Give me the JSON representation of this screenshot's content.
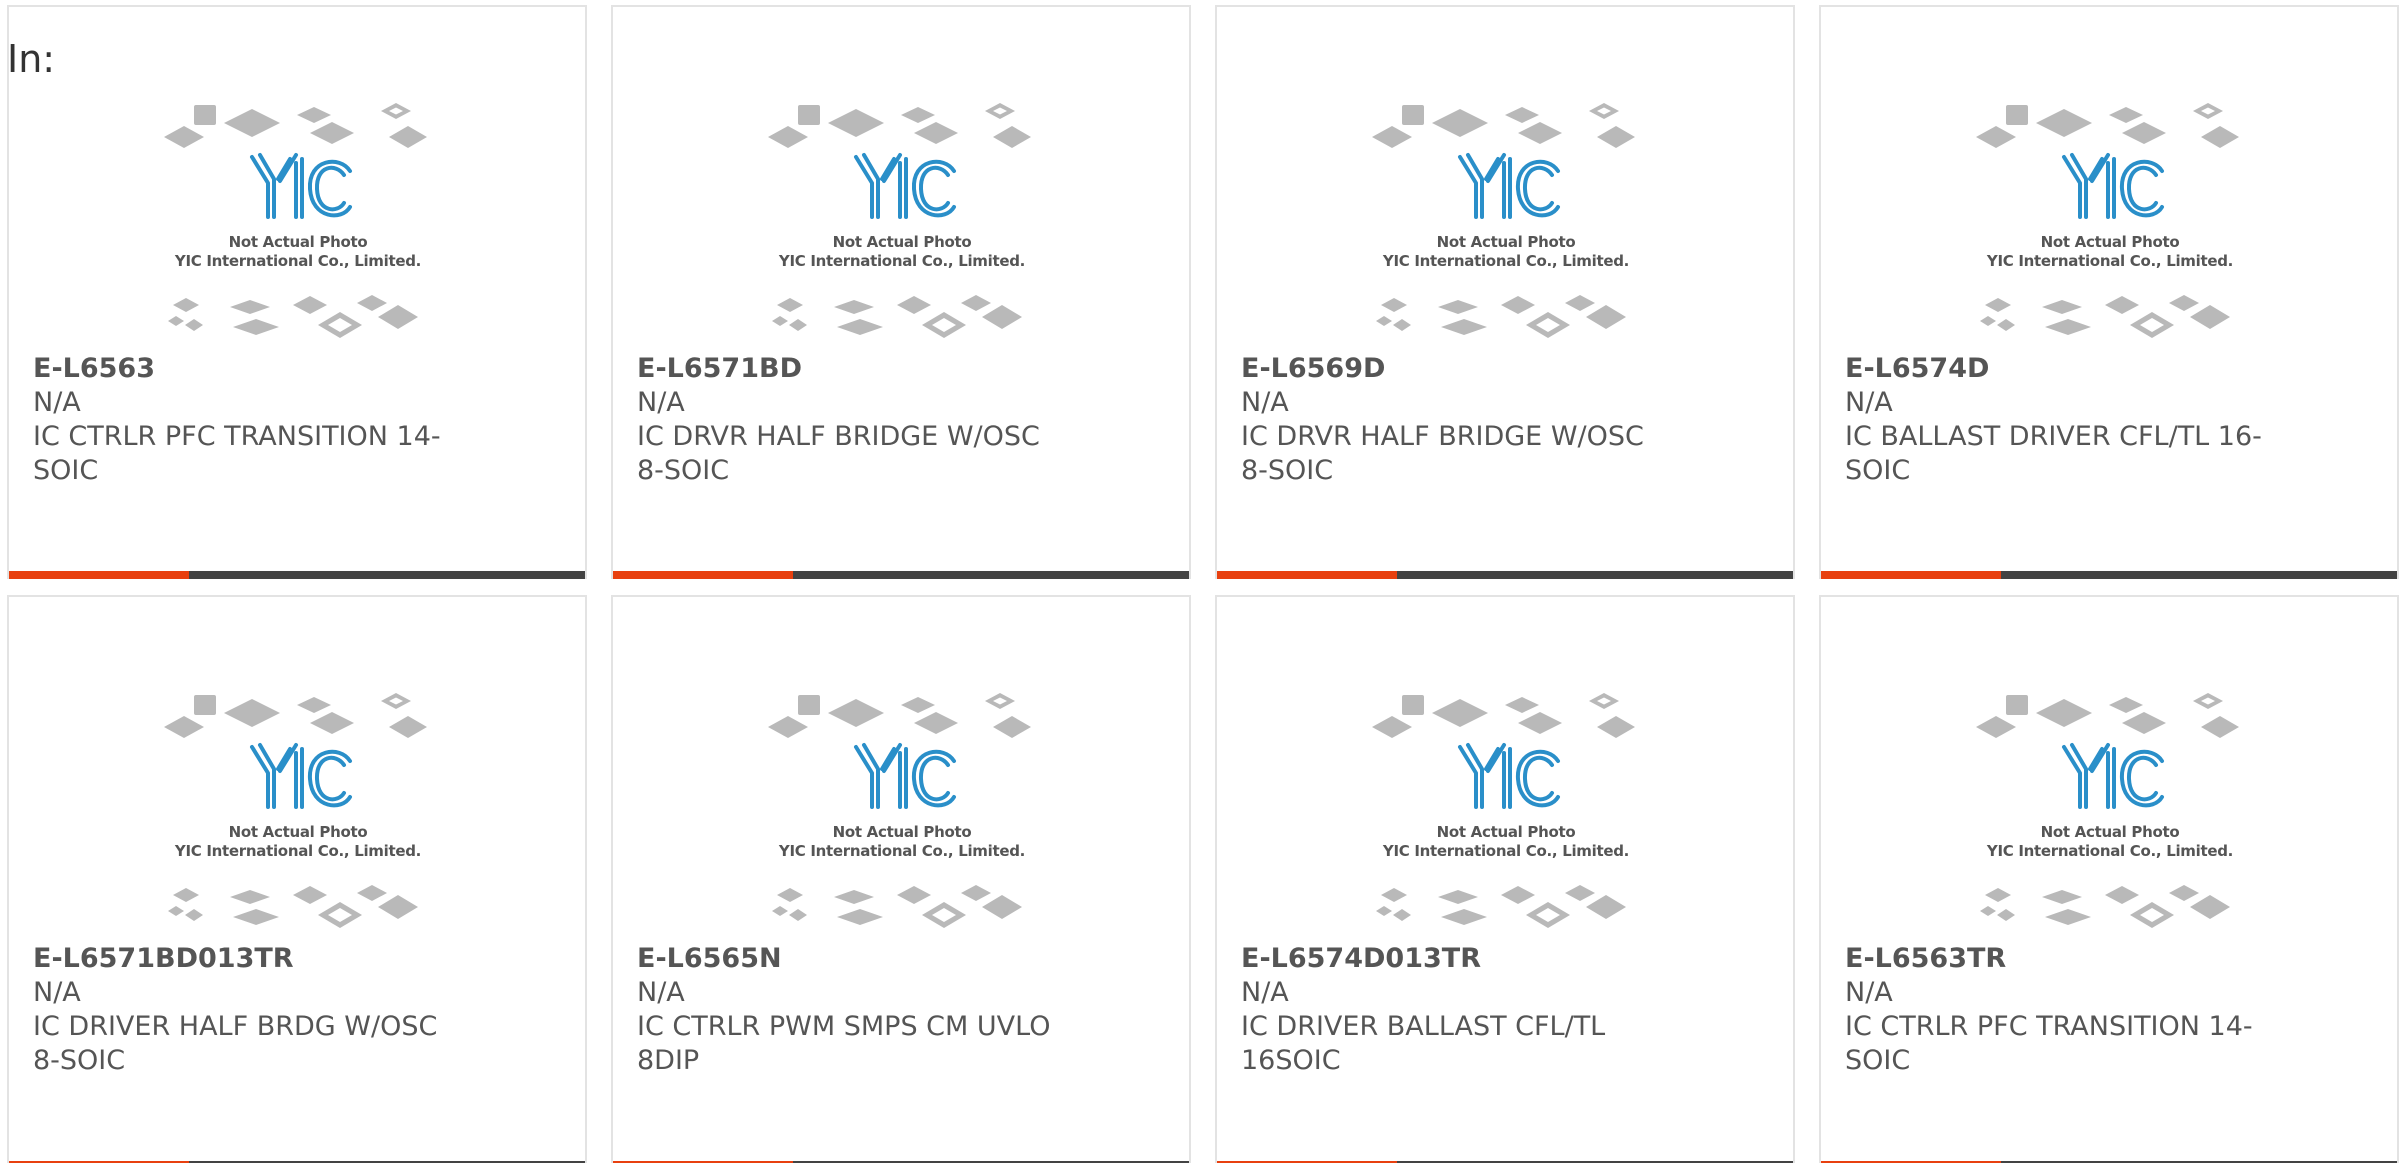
{
  "label": "In:",
  "placeholder_image": {
    "line1": "Not Actual Photo",
    "line2": "YIC International Co., Limited.",
    "logo_text": "YIC",
    "logo_color": "#2a8fc9",
    "chip_color": "#b9b9b9"
  },
  "accent_color": "#e8400f",
  "bar_color": "#434343",
  "products": [
    {
      "part": "E-L6563",
      "mfr": "N/A",
      "desc": "IC CTRLR PFC TRANSITION 14-SOIC"
    },
    {
      "part": "E-L6571BD",
      "mfr": "N/A",
      "desc": "IC DRVR HALF BRIDGE W/OSC 8-SOIC"
    },
    {
      "part": "E-L6569D",
      "mfr": "N/A",
      "desc": "IC DRVR HALF BRIDGE W/OSC 8-SOIC"
    },
    {
      "part": "E-L6574D",
      "mfr": "N/A",
      "desc": "IC BALLAST DRIVER CFL/TL 16-SOIC"
    },
    {
      "part": "E-L6571BD013TR",
      "mfr": "N/A",
      "desc": "IC DRIVER HALF BRDG W/OSC 8-SOIC"
    },
    {
      "part": "E-L6565N",
      "mfr": "N/A",
      "desc": "IC CTRLR PWM SMPS CM UVLO 8DIP"
    },
    {
      "part": "E-L6574D013TR",
      "mfr": "N/A",
      "desc": "IC DRIVER BALLAST CFL/TL 16SOIC"
    },
    {
      "part": "E-L6563TR",
      "mfr": "N/A",
      "desc": "IC CTRLR PFC TRANSITION 14-SOIC"
    }
  ]
}
